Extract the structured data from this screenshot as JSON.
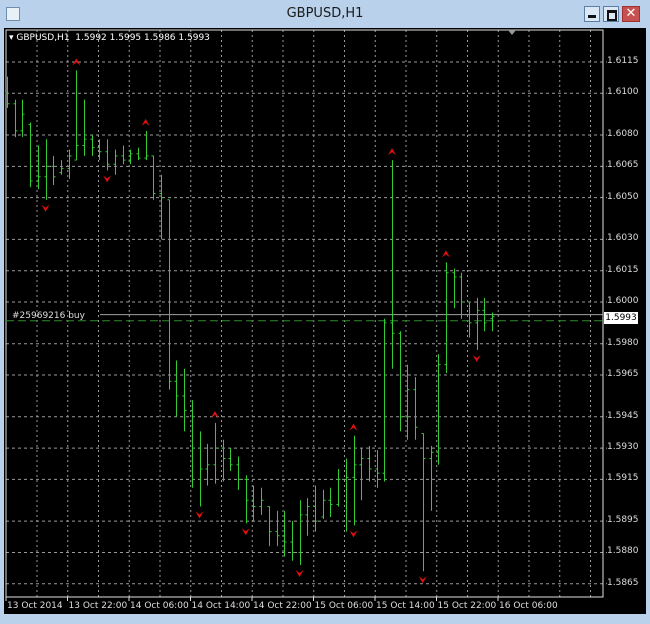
{
  "window": {
    "title": "GBPUSD,H1",
    "close_glyph": "✕"
  },
  "legend": {
    "symbol": "GBPUSD,H1",
    "open": "1.5992",
    "high": "1.5995",
    "low": "1.5986",
    "close": "1.5993"
  },
  "order": {
    "label": "#25969216 buy",
    "price": 1.5991
  },
  "current_price": {
    "label": "1.5993",
    "value": 1.5993
  },
  "colors": {
    "bars": "#33cc33",
    "fractal": "#e01010",
    "grid": "#9a9a9a",
    "order_line": "#2e8b2e",
    "bid_line": "#a0a0a0"
  },
  "price_axis": [
    "1.6115",
    "1.6100",
    "1.6080",
    "1.6065",
    "1.6050",
    "1.6030",
    "1.6015",
    "1.6000",
    "1.5980",
    "1.5965",
    "1.5945",
    "1.5930",
    "1.5915",
    "1.5895",
    "1.5880",
    "1.5865"
  ],
  "time_axis": [
    "13 Oct 2014",
    "13 Oct 22:00",
    "14 Oct 06:00",
    "14 Oct 14:00",
    "14 Oct 22:00",
    "15 Oct 06:00",
    "15 Oct 14:00",
    "15 Oct 22:00",
    "16 Oct 06:00"
  ],
  "chart_data": {
    "type": "ohlc",
    "symbol": "GBPUSD",
    "timeframe": "H1",
    "ylim": [
      1.586,
      1.6125
    ],
    "ohlc": [
      [
        1.61,
        1.6108,
        1.6093,
        1.6095
      ],
      [
        1.6095,
        1.6097,
        1.6079,
        1.6082
      ],
      [
        1.6082,
        1.6097,
        1.6079,
        1.609
      ],
      [
        1.6085,
        1.6086,
        1.6055,
        1.6058
      ],
      [
        1.6058,
        1.6075,
        1.6054,
        1.606
      ],
      [
        1.606,
        1.6078,
        1.6049,
        1.6065
      ],
      [
        1.6065,
        1.607,
        1.6056,
        1.606
      ],
      [
        1.6062,
        1.6068,
        1.6061,
        1.6064
      ],
      [
        1.6064,
        1.6073,
        1.6059,
        1.607
      ],
      [
        1.6068,
        1.6111,
        1.6068,
        1.6075
      ],
      [
        1.6075,
        1.6097,
        1.607,
        1.6078
      ],
      [
        1.6078,
        1.608,
        1.607,
        1.6074
      ],
      [
        1.6074,
        1.6078,
        1.6068,
        1.6072
      ],
      [
        1.6072,
        1.6078,
        1.6063,
        1.6066
      ],
      [
        1.6066,
        1.6073,
        1.6061,
        1.607
      ],
      [
        1.607,
        1.6075,
        1.6066,
        1.6068
      ],
      [
        1.6068,
        1.6073,
        1.6066,
        1.6071
      ],
      [
        1.6071,
        1.6074,
        1.6068,
        1.6069
      ],
      [
        1.6069,
        1.6082,
        1.6068,
        1.607
      ],
      [
        1.607,
        1.607,
        1.6049,
        1.6052
      ],
      [
        1.6052,
        1.6061,
        1.603,
        1.605
      ],
      [
        1.6049,
        1.6049,
        1.5958,
        1.5962
      ],
      [
        1.5962,
        1.5972,
        1.5945,
        1.5955
      ],
      [
        1.5955,
        1.5968,
        1.5938,
        1.5948
      ],
      [
        1.5948,
        1.5953,
        1.5911,
        1.593
      ],
      [
        1.593,
        1.5938,
        1.5902,
        1.592
      ],
      [
        1.592,
        1.5932,
        1.5912,
        1.5922
      ],
      [
        1.5922,
        1.5942,
        1.5913,
        1.593
      ],
      [
        1.593,
        1.5934,
        1.5914,
        1.5925
      ],
      [
        1.5925,
        1.593,
        1.5919,
        1.5922
      ],
      [
        1.5922,
        1.5926,
        1.591,
        1.5915
      ],
      [
        1.5915,
        1.5917,
        1.5894,
        1.5905
      ],
      [
        1.5905,
        1.5912,
        1.5895,
        1.5902
      ],
      [
        1.5902,
        1.5911,
        1.5898,
        1.5905
      ],
      [
        1.5902,
        1.5902,
        1.5883,
        1.589
      ],
      [
        1.589,
        1.59,
        1.5883,
        1.5888
      ],
      [
        1.5888,
        1.59,
        1.5878,
        1.5885
      ],
      [
        1.5885,
        1.5895,
        1.5876,
        1.588
      ],
      [
        1.588,
        1.5905,
        1.5874,
        1.5898
      ],
      [
        1.5898,
        1.5906,
        1.5888,
        1.5902
      ],
      [
        1.5902,
        1.5912,
        1.589,
        1.5895
      ],
      [
        1.5897,
        1.591,
        1.5896,
        1.5905
      ],
      [
        1.5905,
        1.5911,
        1.5897,
        1.5903
      ],
      [
        1.5903,
        1.592,
        1.5902,
        1.5915
      ],
      [
        1.5915,
        1.5925,
        1.589,
        1.5916
      ],
      [
        1.5916,
        1.5936,
        1.5893,
        1.5922
      ],
      [
        1.5922,
        1.593,
        1.5905,
        1.5925
      ],
      [
        1.5925,
        1.5931,
        1.5914,
        1.592
      ],
      [
        1.592,
        1.5929,
        1.5911,
        1.5918
      ],
      [
        1.5918,
        1.5992,
        1.5914,
        1.599
      ],
      [
        1.599,
        1.6068,
        1.5968,
        1.5985
      ],
      [
        1.5985,
        1.5986,
        1.5938,
        1.5945
      ],
      [
        1.5945,
        1.597,
        1.5934,
        1.5958
      ],
      [
        1.5958,
        1.5964,
        1.5934,
        1.594
      ],
      [
        1.5937,
        1.5937,
        1.5871,
        1.5925
      ],
      [
        1.5925,
        1.5931,
        1.59,
        1.5928
      ],
      [
        1.5928,
        1.5975,
        1.5922,
        1.597
      ],
      [
        1.597,
        1.6019,
        1.5966,
        1.6014
      ],
      [
        1.6014,
        1.6016,
        1.5997,
        1.6012
      ],
      [
        1.6012,
        1.6014,
        1.5992,
        1.6
      ],
      [
        1.6,
        1.6,
        1.5983,
        1.599
      ],
      [
        1.599,
        1.6002,
        1.5977,
        1.5996
      ],
      [
        1.5996,
        1.6002,
        1.5986,
        1.599
      ],
      [
        1.5992,
        1.5995,
        1.5986,
        1.5993
      ]
    ],
    "fractals_up": [
      10,
      19,
      28,
      46,
      51,
      58
    ],
    "fractals_down": [
      6,
      14,
      26,
      32,
      39,
      46,
      55,
      62
    ]
  }
}
